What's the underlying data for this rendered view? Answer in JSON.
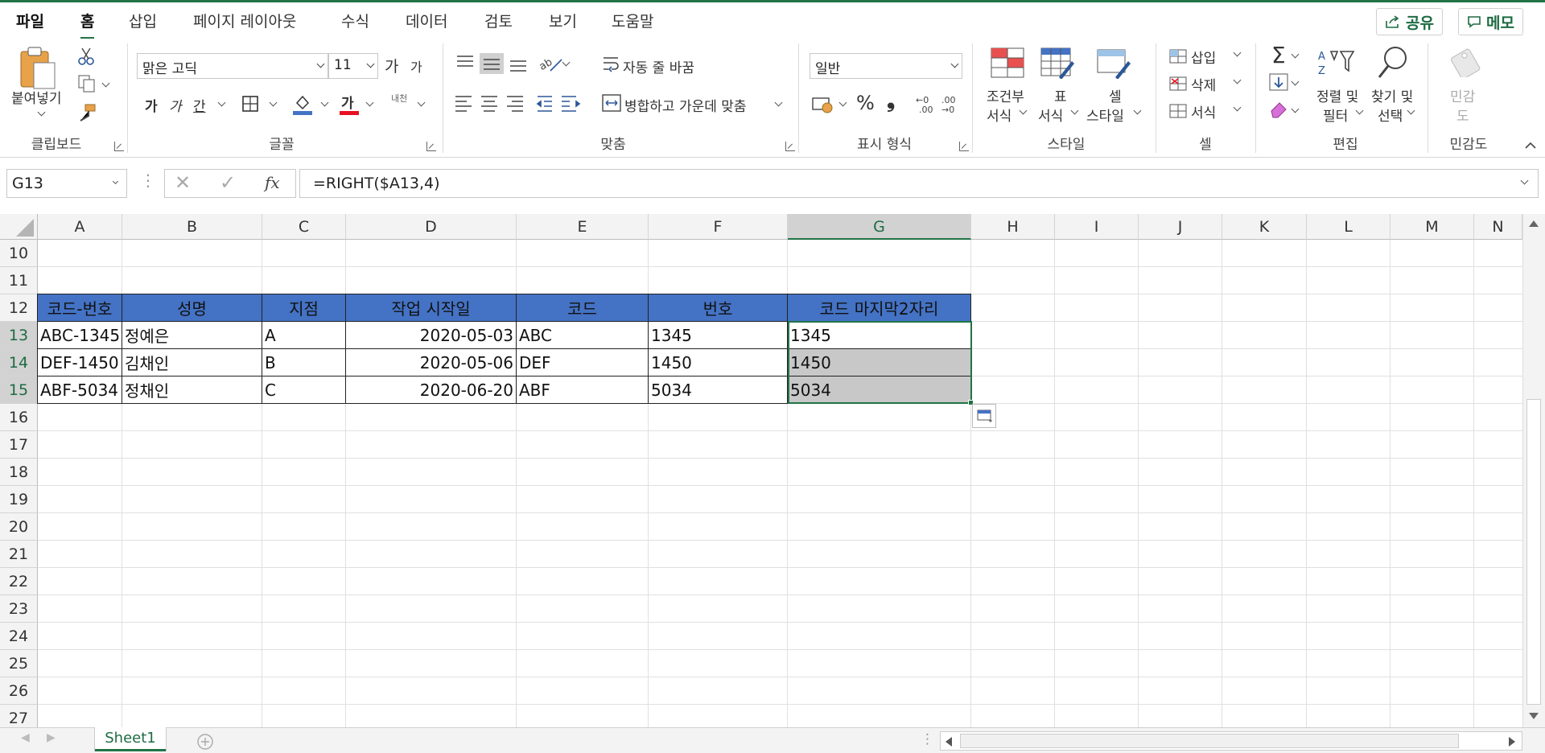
{
  "tabs": [
    "파일",
    "홈",
    "삽입",
    "페이지 레이아웃",
    "수식",
    "데이터",
    "검토",
    "보기",
    "도움말"
  ],
  "active_tab": "홈",
  "top_buttons": {
    "share": "공유",
    "comments": "메모"
  },
  "ribbon": {
    "clipboard": {
      "paste": "붙여넣기",
      "label": "클립보드"
    },
    "font": {
      "name": "맑은 고딕",
      "size": "11",
      "bold": "가",
      "italic": "가",
      "underline": "간",
      "font_color_glyph": "가",
      "phonetic": "내천",
      "grow": "가",
      "shrink": "가",
      "label": "글꼴"
    },
    "alignment": {
      "wrap": "자동 줄 바꿈",
      "merge": "병합하고 가운데 맞춤",
      "label": "맞춤"
    },
    "number": {
      "format": "일반",
      "percent": "%",
      "comma": "❟",
      "label": "표시 형식"
    },
    "styles": {
      "conditional_1": "조건부",
      "conditional_2": "서식",
      "table_1": "표",
      "table_2": "서식",
      "cell_1": "셀",
      "cell_2": "스타일",
      "label": "스타일"
    },
    "cells": {
      "insert": "삽입",
      "delete": "삭제",
      "format": "서식",
      "label": "셀"
    },
    "editing": {
      "sort_1": "정렬 및",
      "sort_2": "필터",
      "find_1": "찾기 및",
      "find_2": "선택",
      "label": "편집"
    },
    "sensitivity": {
      "btn_1": "민감",
      "btn_2": "도",
      "label": "민감도"
    }
  },
  "name_box": "G13",
  "fx": "fx",
  "formula": "=RIGHT($A13,4)",
  "columns": [
    "A",
    "B",
    "C",
    "D",
    "E",
    "F",
    "G",
    "H",
    "I",
    "J",
    "K",
    "L",
    "M",
    "N"
  ],
  "selected_column": "G",
  "rows": [
    "10",
    "11",
    "12",
    "13",
    "14",
    "15",
    "16",
    "17",
    "18",
    "19",
    "20",
    "21",
    "22",
    "23",
    "24",
    "25",
    "26",
    "27"
  ],
  "table": {
    "headers": [
      "코드-번호",
      "성명",
      "지점",
      "작업 시작일",
      "코드",
      "번호",
      "코드 마지막2자리"
    ],
    "data": [
      [
        "ABC-1345",
        "정예은",
        "A",
        "2020-05-03",
        "ABC",
        "1345",
        "1345"
      ],
      [
        "DEF-1450",
        "김채인",
        "B",
        "2020-05-06",
        "DEF",
        "1450",
        "1450"
      ],
      [
        "ABF-5034",
        "정채인",
        "C",
        "2020-06-20",
        "ABF",
        "5034",
        "5034"
      ]
    ]
  },
  "sheet_tab": "Sheet1",
  "colors": {
    "accent": "#217346",
    "table_header": "#4472c4",
    "selection": "#c8c8c8"
  }
}
